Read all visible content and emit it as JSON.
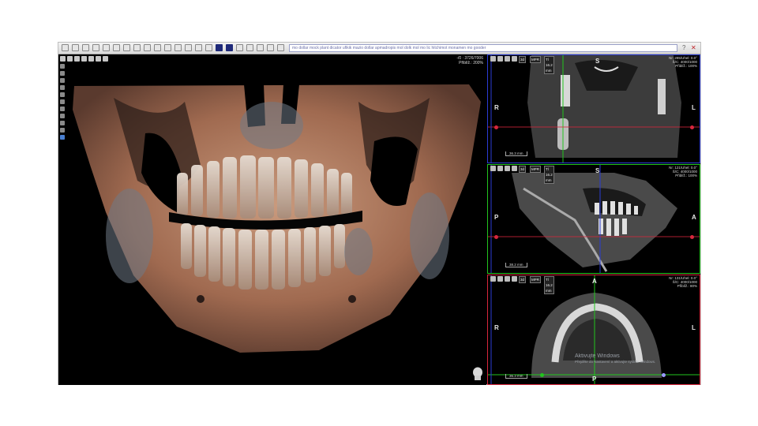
{
  "toolbar": {
    "address_text": "mo dollar mock plant dicator ufikik mazio dollar apmadropis mol dolk mol mo lic hitchimot monamen mo gooder",
    "help_label": "?",
    "close_label": "✕"
  },
  "view_3d": {
    "info_top": "-/0 : 3726/7006",
    "info_zoom": "Přiblíž.: 200%"
  },
  "panes": [
    {
      "id": "coronal",
      "border_color": "#2b3cd6",
      "mode_labels": [
        "3d",
        "MPR",
        "Tl 16.2 mm"
      ],
      "info_lines": [
        "Nr: 285/Uhel: 0.0°",
        "Š/C: 4000/1000",
        "Přiblíž.: 100%"
      ],
      "orient_top": "S",
      "orient_left": "R",
      "orient_right": "L",
      "scale_label": "36.3 mm"
    },
    {
      "id": "sagittal",
      "border_color": "#22c41e",
      "mode_labels": [
        "3d",
        "MPR",
        "Tl 16.2 mm"
      ],
      "info_lines": [
        "Nr: 121/Uhel: 0.0°",
        "Š/C: 4000/1000",
        "Přiblíž.: 100%"
      ],
      "orient_top": "S",
      "orient_left": "P",
      "orient_right": "A",
      "scale_label": "38.2 mm"
    },
    {
      "id": "axial",
      "border_color": "#d8263c",
      "mode_labels": [
        "3d",
        "MPR",
        "Tl 16.2 mm"
      ],
      "info_lines": [
        "Nr: 131/Uhel: 0.0°",
        "Š/C: 4000/1000",
        "Přiblíž.: 80%"
      ],
      "orient_top": "A",
      "orient_left": "R",
      "orient_right": "L",
      "orient_bottom": "P",
      "scale_label": "36.3 mm"
    }
  ],
  "watermark": {
    "line1": "Aktivujte Windows",
    "line2": "Přejděte do Nastavení a aktivujte systém Windows."
  },
  "colors": {
    "coronal_frame": "#2b3cd6",
    "sagittal_frame": "#22c41e",
    "axial_frame": "#d8263c",
    "crosshair_yellow": "#e8e800"
  }
}
